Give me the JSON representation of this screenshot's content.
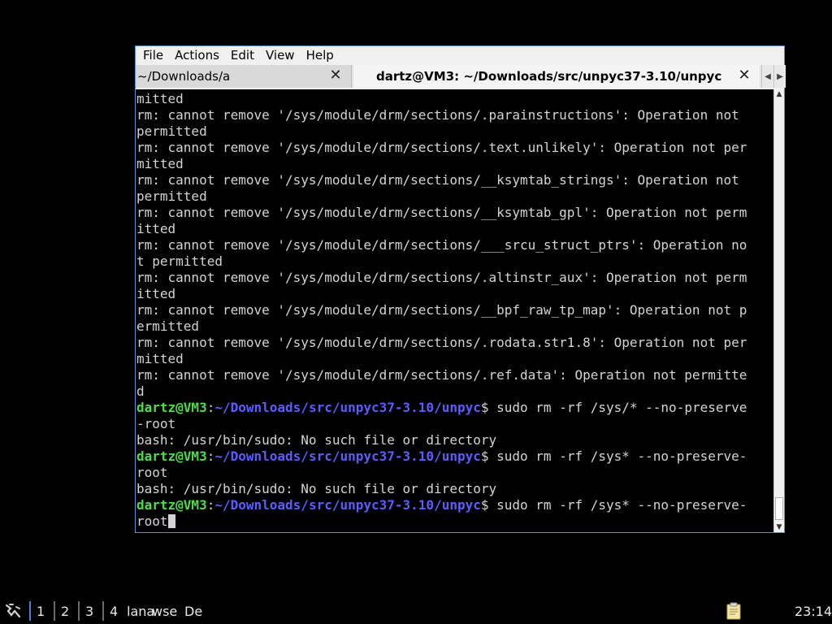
{
  "window": {
    "menu": [
      "File",
      "Actions",
      "Edit",
      "View",
      "Help"
    ],
    "tabs": [
      {
        "label": "~/Downloads/a"
      },
      {
        "label": "dartz@VM3: ~/Downloads/src/unpyc37-3.10/unpyc"
      }
    ]
  },
  "terminal": {
    "lines": [
      "mitted",
      "rm: cannot remove '/sys/module/drm/sections/.parainstructions': Operation not",
      "permitted",
      "rm: cannot remove '/sys/module/drm/sections/.text.unlikely': Operation not per",
      "mitted",
      "rm: cannot remove '/sys/module/drm/sections/__ksymtab_strings': Operation not",
      "permitted",
      "rm: cannot remove '/sys/module/drm/sections/__ksymtab_gpl': Operation not perm",
      "itted",
      "rm: cannot remove '/sys/module/drm/sections/___srcu_struct_ptrs': Operation no",
      "t permitted",
      "rm: cannot remove '/sys/module/drm/sections/.altinstr_aux': Operation not perm",
      "itted",
      "rm: cannot remove '/sys/module/drm/sections/__bpf_raw_tp_map': Operation not p",
      "ermitted",
      "rm: cannot remove '/sys/module/drm/sections/.rodata.str1.8': Operation not per",
      "mitted",
      "rm: cannot remove '/sys/module/drm/sections/.ref.data': Operation not permitte",
      "d"
    ],
    "prompt_user": "dartz@VM3",
    "prompt_sep": ":",
    "prompt_path": "~/Downloads/src/unpyc37-3.10/unpyc",
    "prompt_sign": "$",
    "commands": [
      {
        "cmd": " sudo rm -rf /sys/* --no-preserve",
        "wrap": "-root",
        "output": "bash: /usr/bin/sudo: No such file or directory"
      },
      {
        "cmd": " sudo rm -rf /sys* --no-preserve-",
        "wrap": "root",
        "output": "bash: /usr/bin/sudo: No such file or directory"
      },
      {
        "cmd": " sudo rm -rf /sys* --no-preserve-",
        "wrap": "root",
        "output": ""
      }
    ]
  },
  "taskbar": {
    "workspaces": [
      "1",
      "2",
      "3",
      "4"
    ],
    "tasks": [
      "lana",
      "wse",
      "De"
    ],
    "clock": "23:14",
    "tray_icon": "clipboard-icon",
    "start_icon": "lxqt-start-icon"
  }
}
